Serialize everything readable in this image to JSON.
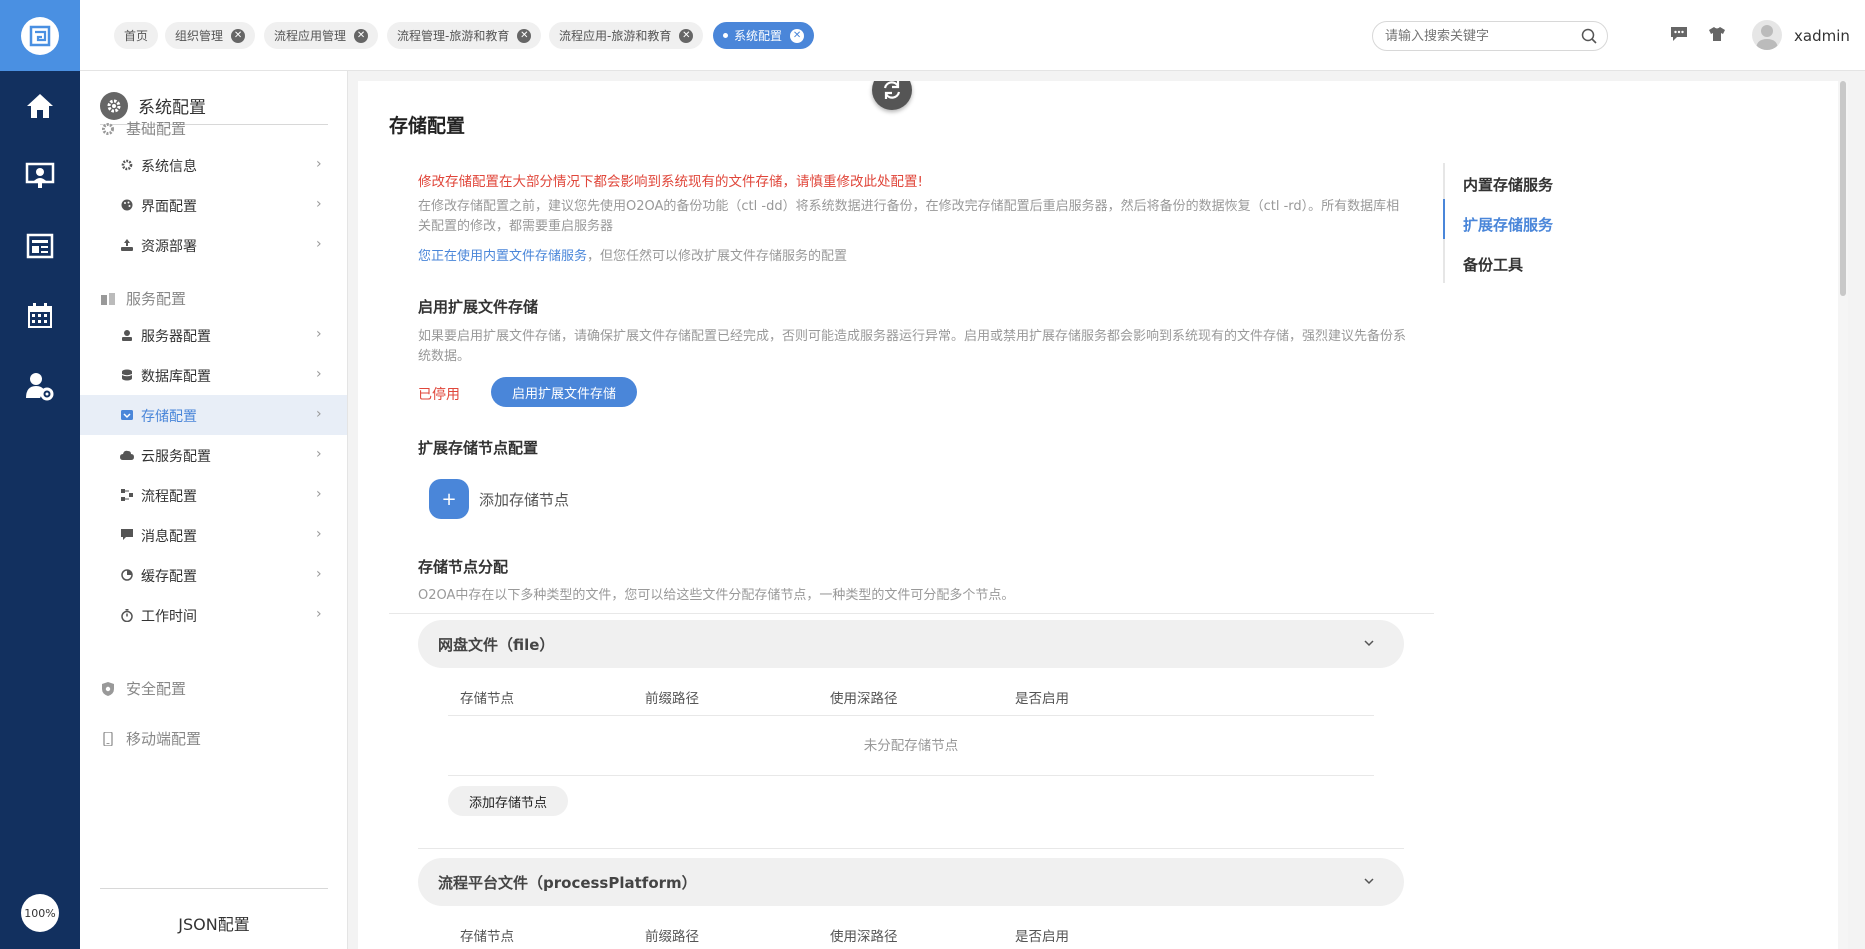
{
  "tabs": [
    {
      "label": "首页",
      "closable": false
    },
    {
      "label": "组织管理",
      "closable": true
    },
    {
      "label": "流程应用管理",
      "closable": true
    },
    {
      "label": "流程管理-旅游和教育",
      "closable": true
    },
    {
      "label": "流程应用-旅游和教育",
      "closable": true
    },
    {
      "label": "系统配置",
      "closable": true,
      "active": true
    }
  ],
  "search": {
    "placeholder": "请输入搜索关键字"
  },
  "user": {
    "name": "xadmin"
  },
  "rail": {
    "zoom": "100%"
  },
  "sidebar": {
    "title": "系统配置",
    "groups": {
      "basic": "基础配置",
      "service": "服务配置",
      "security": "安全配置",
      "mobile": "移动端配置"
    },
    "items": [
      {
        "label": "系统信息"
      },
      {
        "label": "界面配置"
      },
      {
        "label": "资源部署"
      },
      {
        "label": "服务器配置"
      },
      {
        "label": "数据库配置"
      },
      {
        "label": "存储配置"
      },
      {
        "label": "云服务配置"
      },
      {
        "label": "流程配置"
      },
      {
        "label": "消息配置"
      },
      {
        "label": "缓存配置"
      },
      {
        "label": "工作时间"
      }
    ],
    "footer": "JSON配置"
  },
  "main": {
    "title": "存储配置",
    "warning": "修改存储配置在大部分情况下都会影响到系统现有的文件存储，请慎重修改此处配置!",
    "desc1": "在修改存储配置之前，建议您先使用O2OA的备份功能（ctl -dd）将系统数据进行备份，在修改完存储配置后重启服务器，然后将备份的数据恢复（ctl -rd）。所有数据库相关配置的修改，都需要重启服务器",
    "current_link": "您正在使用内置文件存储服务",
    "current_rest": "，但您任然可以修改扩展文件存储服务的配置",
    "enable_section": {
      "title": "启用扩展文件存储",
      "desc": "如果要启用扩展文件存储，请确保扩展文件存储配置已经完成，否则可能造成服务器运行异常。启用或禁用扩展存储服务都会影响到系统现有的文件存储，强烈建议先备份系统数据。",
      "status": "已停用",
      "button": "启用扩展文件存储"
    },
    "node_section": {
      "title": "扩展存储节点配置",
      "add_label": "添加存储节点",
      "plus": "+"
    },
    "dist_section": {
      "title": "存储节点分配",
      "desc": "O2OA中存在以下多种类型的文件，您可以给这些文件分配存储节点，一种类型的文件可分配多个节点。"
    },
    "file_types": [
      {
        "title": "网盘文件（file）",
        "columns": [
          "存储节点",
          "前缀路径",
          "使用深路径",
          "是否启用"
        ],
        "empty": "未分配存储节点",
        "add_button": "添加存储节点"
      },
      {
        "title": "流程平台文件（processPlatform）",
        "columns": [
          "存储节点",
          "前缀路径",
          "使用深路径",
          "是否启用"
        ]
      }
    ]
  },
  "anchor_nav": [
    {
      "label": "内置存储服务"
    },
    {
      "label": "扩展存储服务",
      "active": true
    },
    {
      "label": "备份工具"
    }
  ]
}
